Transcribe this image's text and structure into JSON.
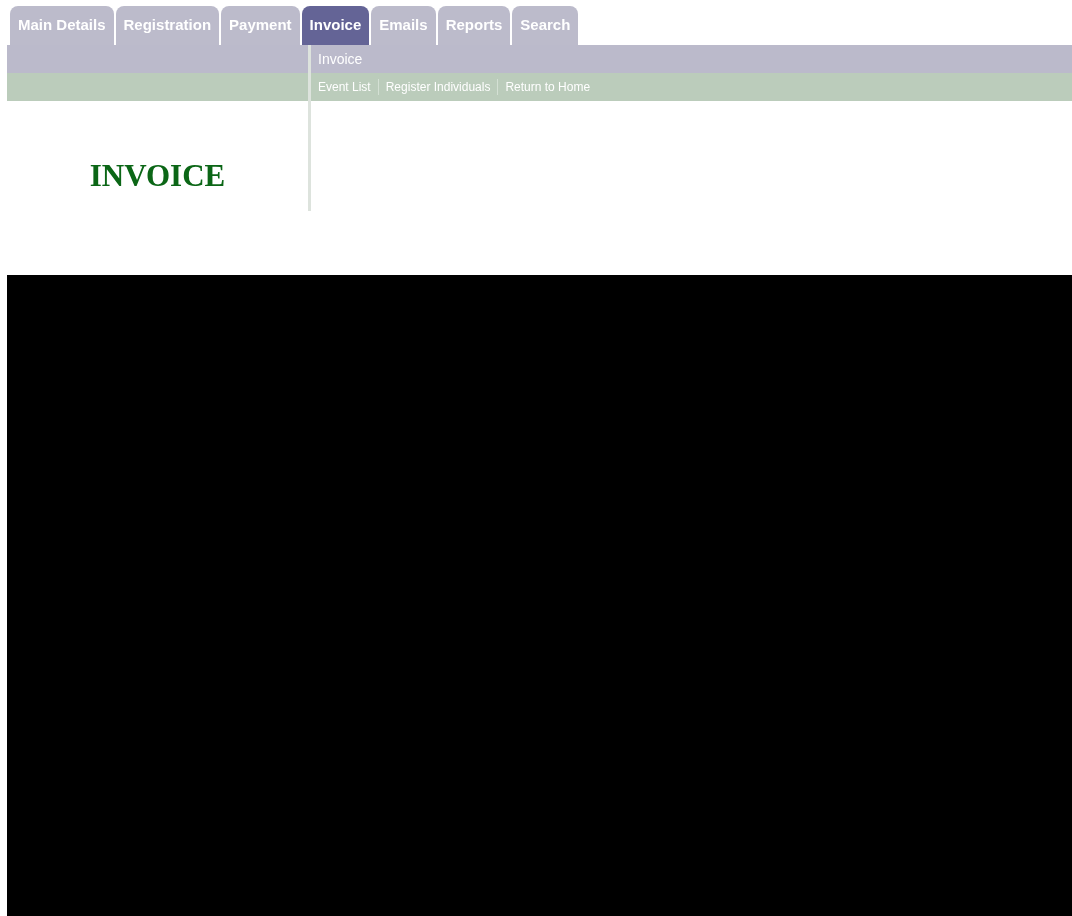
{
  "tabs": [
    {
      "label": "Main Details",
      "selected": false
    },
    {
      "label": "Registration",
      "selected": false
    },
    {
      "label": "Payment",
      "selected": false
    },
    {
      "label": "Invoice",
      "selected": true
    },
    {
      "label": "Emails",
      "selected": false
    },
    {
      "label": "Reports",
      "selected": false
    },
    {
      "label": "Search",
      "selected": false
    }
  ],
  "left_panel": {
    "heading": "INVOICE"
  },
  "content": {
    "title": "Invoice",
    "links": [
      "Event List",
      "Register Individuals",
      "Return to Home"
    ]
  }
}
